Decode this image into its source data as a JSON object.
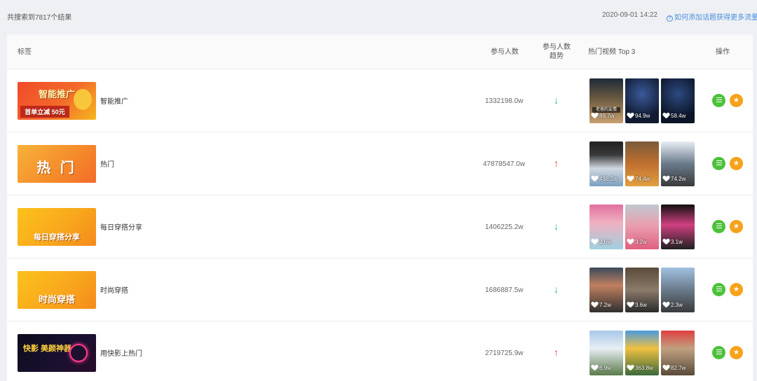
{
  "header": {
    "result_count": "共搜索到7817个结果",
    "timestamp": "2020-09-01 14:22",
    "help_link": "如何添加话题获得更多流量"
  },
  "table": {
    "columns": {
      "tag": "标签",
      "participants": "参与人数",
      "trend_line1": "参与人数",
      "trend_line2": "趋势",
      "hot_videos": "热门视频 Top 3",
      "actions": "操作"
    },
    "rows": [
      {
        "name": "智能推广",
        "banner_text": "智能推广",
        "banner_sub": "首单立减 50元",
        "participants": "1332198.0w",
        "trend": "down",
        "trend_symbol": "↓",
        "videos": [
          {
            "likes": "89.7w",
            "caption": "老爸的友情"
          },
          {
            "likes": "94.9w"
          },
          {
            "likes": "58.4w"
          }
        ]
      },
      {
        "name": "热门",
        "banner_text": "热 门",
        "participants": "47878547.0w",
        "trend": "up",
        "trend_symbol": "↑",
        "videos": [
          {
            "likes": "438.2w"
          },
          {
            "likes": "74.4w"
          },
          {
            "likes": "74.2w"
          }
        ]
      },
      {
        "name": "每日穿搭分享",
        "banner_text": "每日穿搭分享",
        "participants": "1406225.2w",
        "trend": "down",
        "trend_symbol": "↓",
        "videos": [
          {
            "likes": "2.6w"
          },
          {
            "likes": "3.2w"
          },
          {
            "likes": "3.1w"
          }
        ]
      },
      {
        "name": "时尚穿搭",
        "banner_text": "时尚穿搭",
        "participants": "1686887.5w",
        "trend": "down",
        "trend_symbol": "↓",
        "videos": [
          {
            "likes": "7.2w"
          },
          {
            "likes": "3.6w"
          },
          {
            "likes": "2.3w"
          }
        ]
      },
      {
        "name": "用快影上热门",
        "banner_text": "快影 美颜神器",
        "participants": "2719725.9w",
        "trend": "up",
        "trend_symbol": "↑",
        "videos": [
          {
            "likes": "6.9w"
          },
          {
            "likes": "363.8w"
          },
          {
            "likes": "82.7w"
          }
        ]
      }
    ]
  },
  "icons": {
    "help": "question-circle-icon",
    "detail_action": "document-icon",
    "favorite_action": "star-icon",
    "like": "heart-icon"
  },
  "colors": {
    "trend_down": "#2bb673",
    "trend_up": "#f03c3c",
    "detail_button": "#4cc13a",
    "favorite_button": "#f7a21b",
    "link": "#4a8fe0"
  }
}
